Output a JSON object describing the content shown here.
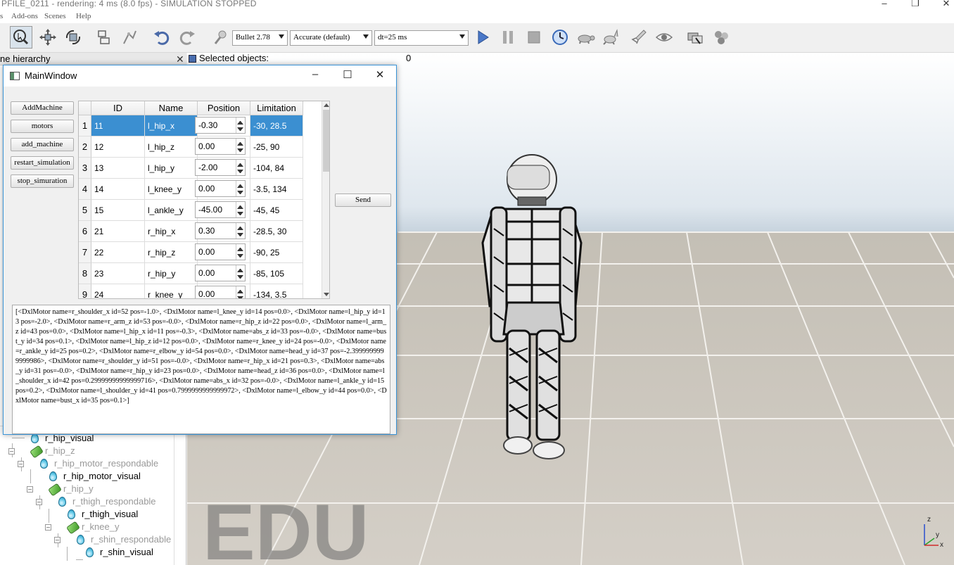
{
  "app": {
    "title": "PFILE_0211 - rendering: 4 ms (8.0 fps) - SIMULATION STOPPED"
  },
  "menu": [
    "Add-ons",
    "Scenes",
    "Help"
  ],
  "toolbar": {
    "engine": "Bullet 2.78",
    "accuracy": "Accurate (default)",
    "timestep": "dt=25 ms"
  },
  "hierarchy": {
    "title": "ne hierarchy",
    "items": [
      {
        "label": "r_hip_visual",
        "icon": "shape",
        "grey": false
      },
      {
        "label": "r_hip_z",
        "icon": "joint",
        "grey": true
      },
      {
        "label": "r_hip_motor_respondable",
        "icon": "shape",
        "grey": true
      },
      {
        "label": "r_hip_motor_visual",
        "icon": "shape",
        "grey": false
      },
      {
        "label": "r_hip_y",
        "icon": "joint",
        "grey": true
      },
      {
        "label": "r_thigh_respondable",
        "icon": "shape",
        "grey": true
      },
      {
        "label": "r_thigh_visual",
        "icon": "shape",
        "grey": false
      },
      {
        "label": "r_knee_y",
        "icon": "joint",
        "grey": true
      },
      {
        "label": "r_shin_respondable",
        "icon": "shape",
        "grey": true
      },
      {
        "label": "r_shin_visual",
        "icon": "shape",
        "grey": false
      }
    ]
  },
  "viewport": {
    "selected_label": "Selected objects:",
    "selected_count": "0",
    "watermark": "EDU",
    "axis_z": "z",
    "axis_y": "y",
    "axis_x": "x"
  },
  "dialog": {
    "title": "MainWindow",
    "buttons": [
      "AddMachine",
      "motors",
      "add_machine",
      "restart_simulation",
      "stop_simuration"
    ],
    "send": "Send",
    "columns": [
      "ID",
      "Name",
      "Position",
      "Limitation"
    ],
    "rows": [
      {
        "n": "1",
        "id": "11",
        "name": "l_hip_x",
        "pos": "-0.30",
        "lim": "-30, 28.5"
      },
      {
        "n": "2",
        "id": "12",
        "name": "l_hip_z",
        "pos": "0.00",
        "lim": "-25, 90"
      },
      {
        "n": "3",
        "id": "13",
        "name": "l_hip_y",
        "pos": "-2.00",
        "lim": "-104, 84"
      },
      {
        "n": "4",
        "id": "14",
        "name": "l_knee_y",
        "pos": "0.00",
        "lim": "-3.5, 134"
      },
      {
        "n": "5",
        "id": "15",
        "name": "l_ankle_y",
        "pos": "-45.00",
        "lim": "-45, 45"
      },
      {
        "n": "6",
        "id": "21",
        "name": "r_hip_x",
        "pos": "0.30",
        "lim": "-28.5, 30"
      },
      {
        "n": "7",
        "id": "22",
        "name": "r_hip_z",
        "pos": "0.00",
        "lim": "-90, 25"
      },
      {
        "n": "8",
        "id": "23",
        "name": "r_hip_y",
        "pos": "0.00",
        "lim": "-85, 105"
      },
      {
        "n": "9",
        "id": "24",
        "name": "r_knee_y",
        "pos": "0.00",
        "lim": "-134, 3.5"
      }
    ],
    "output": "[<DxlMotor name=r_shoulder_x id=52 pos=-1.0>, <DxlMotor name=l_knee_y id=14 pos=0.0>, <DxlMotor name=l_hip_y id=13 pos=-2.0>, <DxlMotor name=r_arm_z id=53 pos=-0.0>, <DxlMotor name=r_hip_z id=22 pos=0.0>, <DxlMotor name=l_arm_z id=43 pos=0.0>, <DxlMotor name=l_hip_x id=11 pos=-0.3>, <DxlMotor name=abs_z id=33 pos=-0.0>, <DxlMotor name=bust_y id=34 pos=0.1>, <DxlMotor name=l_hip_z id=12 pos=0.0>, <DxlMotor name=r_knee_y id=24 pos=-0.0>, <DxlMotor name=r_ankle_y id=25 pos=0.2>, <DxlMotor name=r_elbow_y id=54 pos=0.0>, <DxlMotor name=head_y id=37 pos=-2.3999999999999986>, <DxlMotor name=r_shoulder_y id=51 pos=-0.0>, <DxlMotor name=r_hip_x id=21 pos=0.3>, <DxlMotor name=abs_y id=31 pos=-0.0>, <DxlMotor name=r_hip_y id=23 pos=0.0>, <DxlMotor name=head_z id=36 pos=0.0>, <DxlMotor name=l_shoulder_x id=42 pos=0.29999999999999716>, <DxlMotor name=abs_x id=32 pos=-0.0>, <DxlMotor name=l_ankle_y id=15 pos=0.2>, <DxlMotor name=l_shoulder_y id=41 pos=0.7999999999999972>, <DxlMotor name=l_elbow_y id=44 pos=0.0>, <DxlMotor name=bust_x id=35 pos=0.1>]"
  }
}
